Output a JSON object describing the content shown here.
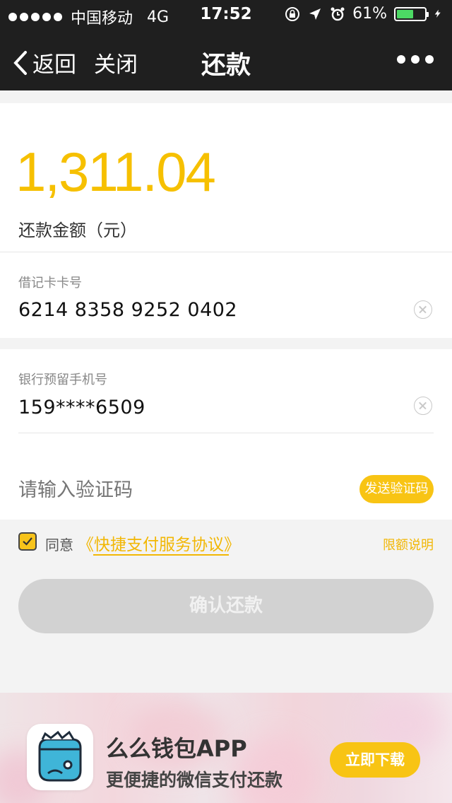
{
  "status_bar": {
    "carrier": "中国移动",
    "network": "4G",
    "time": "17:52",
    "battery_percent": "61%",
    "battery_level": 0.61,
    "icons": [
      "lock-rotation-icon",
      "location-arrow-icon",
      "alarm-icon",
      "charging-bolt-icon"
    ]
  },
  "nav": {
    "back_label": "返回",
    "close_label": "关闭",
    "title": "还款"
  },
  "amount": {
    "value": "1,311.04",
    "label": "还款金额（元）"
  },
  "card_field": {
    "label": "借记卡卡号",
    "value": "6214 8358 9252 0402"
  },
  "phone_field": {
    "label": "银行预留手机号",
    "value": "159****6509"
  },
  "code_field": {
    "placeholder": "请输入验证码",
    "send_label": "发送验证码"
  },
  "agreement": {
    "checked": true,
    "agree_label": "同意",
    "protocol_label": "《快捷支付服务协议》",
    "limit_label": "限额说明"
  },
  "confirm_label": "确认还款",
  "banner": {
    "app_name": "么么钱包APP",
    "slogan": "更便捷的微信支付还款",
    "download_label": "立即下载"
  },
  "colors": {
    "accent": "#f8c414",
    "amount": "#f6c000",
    "nav_bg": "#1f1f1f",
    "disabled_button": "#d2d2d2",
    "app_icon_blue": "#3fb5d8"
  }
}
